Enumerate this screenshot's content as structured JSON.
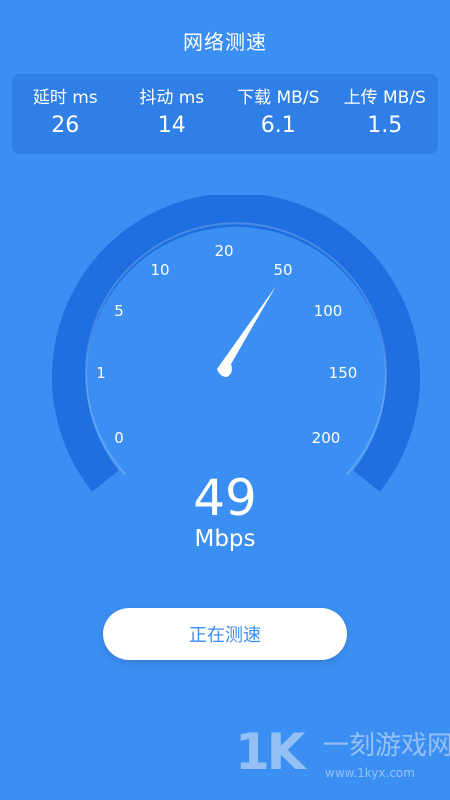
{
  "header": {
    "title": "网络测速"
  },
  "stats": [
    {
      "label": "延时 ms",
      "value": "26"
    },
    {
      "label": "抖动 ms",
      "value": "14"
    },
    {
      "label": "下载 MB/S",
      "value": "6.1"
    },
    {
      "label": "上传 MB/S",
      "value": "1.5"
    }
  ],
  "gauge": {
    "scale_labels": [
      "0",
      "1",
      "5",
      "10",
      "20",
      "50",
      "100",
      "150",
      "200"
    ],
    "needle_value": 49
  },
  "speed": {
    "value": "49",
    "unit": "Mbps"
  },
  "action": {
    "button_label": "正在测速"
  },
  "watermark": {
    "logo": "1K",
    "name": "一刻游戏网",
    "url": "www.1kyx.com"
  },
  "colors": {
    "background": "#3b8ff3",
    "panel": "#2f7fe6",
    "gauge_ring": "#1f6fe0",
    "button_bg": "#ffffff",
    "button_text": "#3b8ff3"
  }
}
